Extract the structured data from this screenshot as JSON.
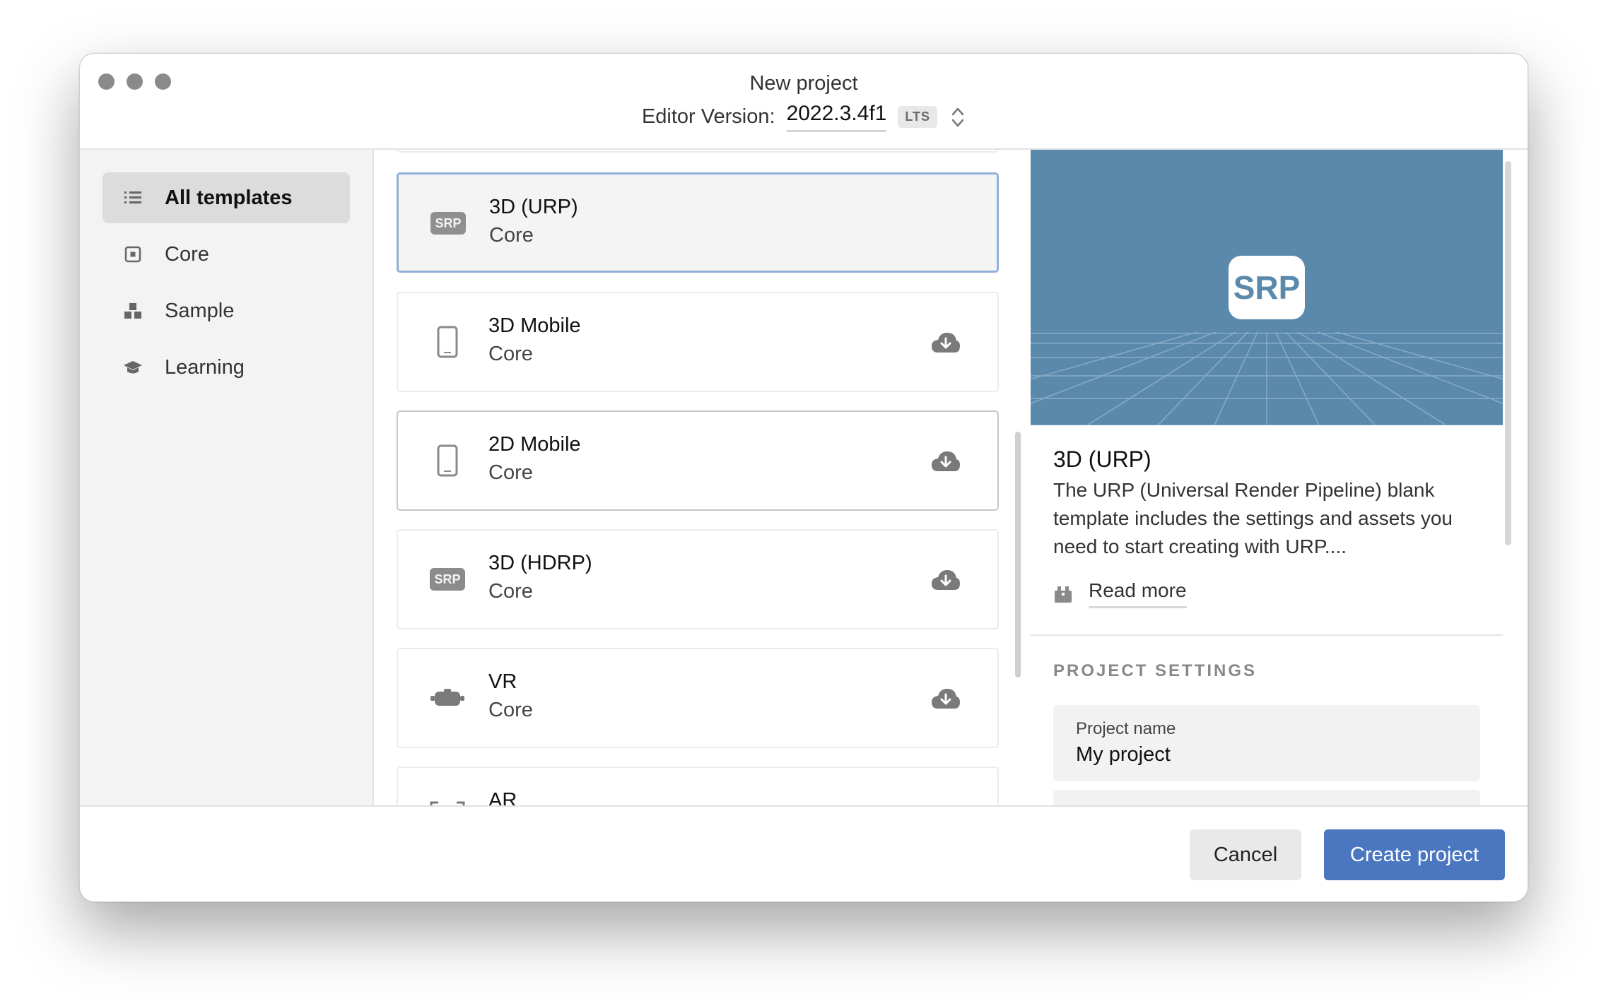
{
  "window": {
    "title": "New project",
    "editor_version_label": "Editor Version:",
    "editor_version_value": "2022.3.4f1",
    "lts_badge": "LTS"
  },
  "sidebar": {
    "items": [
      {
        "label": "All templates",
        "icon": "list-icon",
        "active": true
      },
      {
        "label": "Core",
        "icon": "square-dot-icon",
        "active": false
      },
      {
        "label": "Sample",
        "icon": "blocks-icon",
        "active": false
      },
      {
        "label": "Learning",
        "icon": "graduation-cap-icon",
        "active": false
      }
    ]
  },
  "templates": [
    {
      "title": "3D (URP)",
      "category": "Core",
      "icon": "srp-icon",
      "badge": "SRP",
      "selected": true,
      "download": false
    },
    {
      "title": "3D Mobile",
      "category": "Core",
      "icon": "mobile-phone-icon",
      "selected": false,
      "download": true
    },
    {
      "title": "2D Mobile",
      "category": "Core",
      "icon": "mobile-phone-icon",
      "selected": false,
      "download": true
    },
    {
      "title": "3D (HDRP)",
      "category": "Core",
      "icon": "srp-icon",
      "badge": "SRP",
      "selected": false,
      "download": true
    },
    {
      "title": "VR",
      "category": "Core",
      "icon": "vr-headset-icon",
      "selected": false,
      "download": true
    },
    {
      "title": "AR",
      "category": "",
      "icon": "ar-frame-icon",
      "selected": false,
      "download": false
    }
  ],
  "details": {
    "preview_badge": "SRP",
    "title": "3D (URP)",
    "description": "The URP (Universal Render Pipeline) blank template includes the settings and assets you need to start creating with URP....",
    "read_more": "Read more",
    "settings_heading": "PROJECT SETTINGS",
    "project_name_label": "Project name",
    "project_name_value": "My project"
  },
  "footer": {
    "cancel_label": "Cancel",
    "create_label": "Create project"
  },
  "colors": {
    "accent": "#4a77bf",
    "preview_bg": "#5a89ac",
    "selected_border": "#8fb0d8"
  }
}
